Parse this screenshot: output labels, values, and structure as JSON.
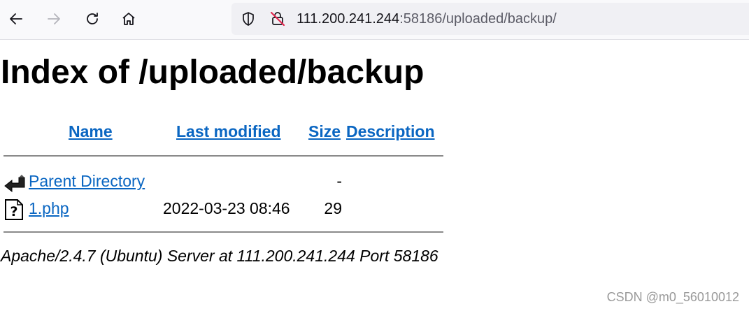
{
  "browser": {
    "url_host": "111.200.241.244",
    "url_rest": ":58186/uploaded/backup/"
  },
  "page": {
    "title": "Index of /uploaded/backup",
    "columns": {
      "name": "Name",
      "last_modified": "Last modified",
      "size": "Size",
      "description": "Description"
    },
    "rows": [
      {
        "icon": "back-arrow-icon",
        "name": "Parent Directory",
        "date": "",
        "size": "-"
      },
      {
        "icon": "unknown-file-icon",
        "name": "1.php",
        "date": "2022-03-23 08:46",
        "size": "29"
      }
    ],
    "address": "Apache/2.4.7 (Ubuntu) Server at 111.200.241.244 Port 58186"
  },
  "watermark": "CSDN @m0_56010012",
  "colors": {
    "link": "#0a66c2",
    "toolbar_bg": "#f9f9fb",
    "urlbar_bg": "#f0f0f4"
  }
}
